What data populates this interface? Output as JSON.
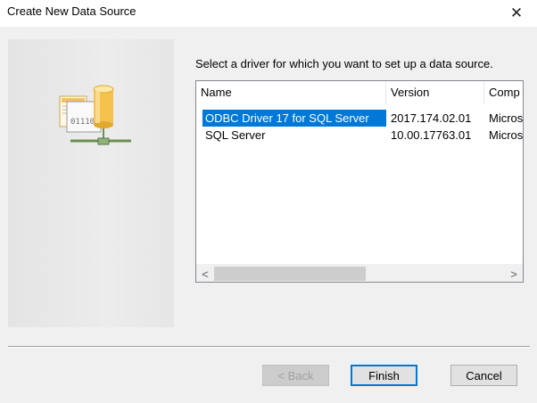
{
  "window": {
    "title": "Create New Data Source",
    "close_glyph": "✕",
    "close_icon": "close-icon"
  },
  "wizard": {
    "image_icon": "database-network-icon",
    "image_text": "01110"
  },
  "prompt": "Select a driver for which you want to set up a data source.",
  "driver_list": {
    "columns": [
      "Name",
      "Version",
      "Comp"
    ],
    "rows": [
      {
        "name": "ODBC Driver 17 for SQL Server",
        "version": "2017.174.02.01",
        "company": "Micros",
        "selected": true
      },
      {
        "name": "SQL Server",
        "version": "10.00.17763.01",
        "company": "Micros",
        "selected": false
      }
    ],
    "scroll_left_glyph": "<",
    "scroll_right_glyph": ">"
  },
  "buttons": {
    "back": "< Back",
    "finish": "Finish",
    "cancel": "Cancel"
  },
  "colors": {
    "selection": "#0078d7",
    "window_bg": "#f0f0f0",
    "default_button_border": "#0078d7"
  }
}
